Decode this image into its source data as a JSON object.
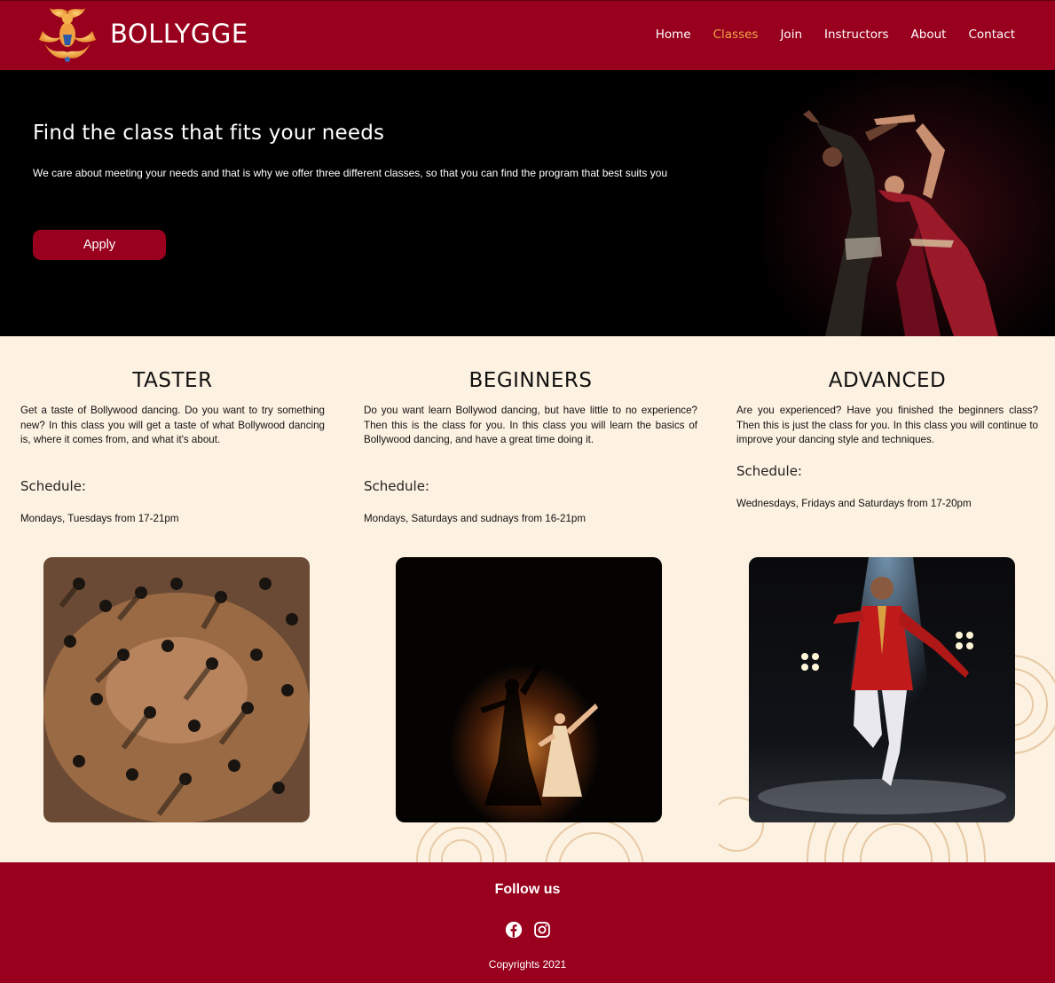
{
  "header": {
    "brand": "BOLLYGGE",
    "nav": [
      "Home",
      "Classes",
      "Join",
      "Instructors",
      "About",
      "Contact"
    ],
    "active_nav": "Classes",
    "color": "#98001d"
  },
  "hero": {
    "title": "Find the class that fits your needs",
    "text": "We care about meeting your needs and that is why we offer three different classes, so that you can find the program that best suits you",
    "button": "Apply"
  },
  "classes": [
    {
      "title": "TASTER",
      "description": "Get a taste of Bollywood dancing. Do you want to try something new? In this class you will get a taste of what Bollywood dancing is, where it comes from, and what it's about.",
      "schedule_heading": "Schedule:",
      "schedule": "Mondays, Tuesdays from 17-21pm"
    },
    {
      "title": "BEGINNERS",
      "description": "Do you want learn Bollywod dancing, but have little to no experience? Then this is the class for you. In this class you will learn the basics of Bollywood dancing, and have a great time doing it.",
      "schedule_heading": "Schedule:",
      "schedule": "Mondays, Saturdays and sudnays from 16-21pm"
    },
    {
      "title": "ADVANCED",
      "description": "Are you experienced? Have you finished the beginners class? Then this is just the class for you. In this class you will continue to improve your dancing style and techniques.",
      "schedule_heading": "Schedule:",
      "schedule": "Wednesdays, Fridays and Saturdays from 17-20pm"
    }
  ],
  "footer": {
    "follow": "Follow us",
    "socials": [
      "facebook-icon",
      "instagram-icon"
    ],
    "copyright": "Copyrights 2021"
  },
  "colors": {
    "brand": "#98001d",
    "accent": "#f2a64c",
    "background": "#fdf1e1"
  }
}
